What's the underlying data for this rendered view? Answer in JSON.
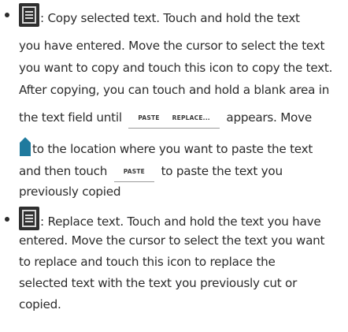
{
  "copy_item": {
    "icon": "copy-icon",
    "lines": [
      ": Copy selected text. Touch and hold the text",
      "you have entered. Move the cursor to select the text",
      "you want to copy and touch this icon to copy the text.",
      "After copying, you can touch and hold a blank area in"
    ],
    "line5_before": "the text field until",
    "popup_paste": "PASTE",
    "popup_replace": "REPLACE...",
    "line5_after": "appears. Move",
    "handle_icon": "cursor-handle-icon",
    "line6_after": "to the location where you want to paste the text",
    "line7_before": "and then touch",
    "paste_button": "PASTE",
    "line7_after": "to paste the text you",
    "line8": "previously copied"
  },
  "replace_item": {
    "icon": "replace-icon",
    "lines": [
      ": Replace text. Touch and hold the text you have",
      "entered. Move the cursor to select the text you want",
      "to replace and touch this icon to replace the",
      "selected text with the text you previously cut or",
      "copied."
    ]
  },
  "colors": {
    "text": "#2b2b2b",
    "icon_bg": "#2f2f2f",
    "handle": "#1f7a9e"
  }
}
